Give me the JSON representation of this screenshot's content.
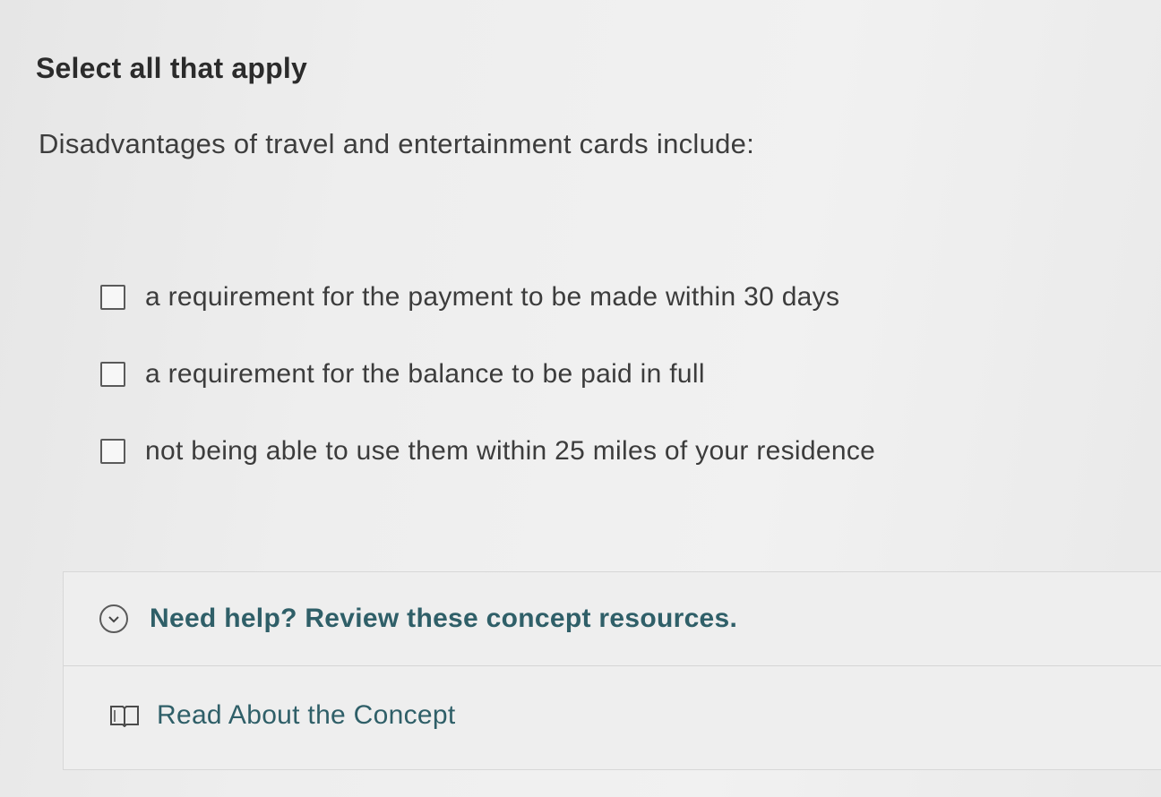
{
  "instruction": "Select all that apply",
  "question": "Disadvantages of travel and entertainment cards include:",
  "choices": [
    {
      "label": "a requirement for the payment to be made within 30 days",
      "checked": false
    },
    {
      "label": "a requirement for the balance to be paid in full",
      "checked": false
    },
    {
      "label": "not being able to use them within 25 miles of your residence",
      "checked": false
    }
  ],
  "help": {
    "title": "Need help? Review these concept resources.",
    "resource_label": "Read About the Concept",
    "icons": {
      "toggle": "chevron-down-circle-icon",
      "resource": "book-icon"
    }
  },
  "colors": {
    "link_teal": "#2f5f68",
    "text": "#3c3c3c"
  }
}
